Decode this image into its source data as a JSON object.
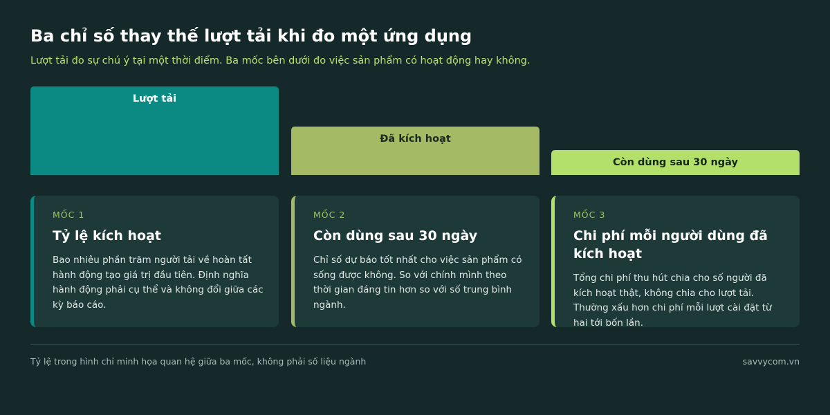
{
  "header": {
    "title": "Ba chỉ số thay thế lượt tải khi đo một ứng dụng",
    "subtitle": "Lượt tải đo sự chú ý tại một thời điểm. Ba mốc bên dưới đo việc sản phẩm có hoạt động hay không."
  },
  "funnel": {
    "stages": [
      {
        "label": "Lượt tải",
        "relative_level": 1.0,
        "color": "#0b8a84"
      },
      {
        "label": "Đã kích hoạt",
        "relative_level": 0.55,
        "color": "#a5ba65"
      },
      {
        "label": "Còn dùng sau 30 ngày",
        "relative_level": 0.28,
        "color": "#b3e06a"
      }
    ]
  },
  "cards": [
    {
      "kicker": "Mốc 1",
      "title": "Tỷ lệ kích hoạt",
      "text": "Bao nhiêu phần trăm người tải về hoàn tất hành động tạo giá trị đầu tiên. Định nghĩa hành động phải cụ thể và không đổi giữa các kỳ báo cáo."
    },
    {
      "kicker": "Mốc 2",
      "title": "Còn dùng sau 30 ngày",
      "text": "Chỉ số dự báo tốt nhất cho việc sản phẩm có sống được không. So với chính mình theo thời gian đáng tin hơn so với số trung bình ngành."
    },
    {
      "kicker": "Mốc 3",
      "title": "Chi phí mỗi người dùng đã kích hoạt",
      "text": "Tổng chi phí thu hút chia cho số người đã kích hoạt thật, không chia cho lượt tải. Thường xấu hơn chi phí mỗi lượt cài đặt từ hai tới bốn lần."
    }
  ],
  "footer": {
    "note": "Tỷ lệ trong hình chỉ minh họa quan hệ giữa ba mốc, không phải số liệu ngành",
    "source": "savvycom.vn"
  }
}
